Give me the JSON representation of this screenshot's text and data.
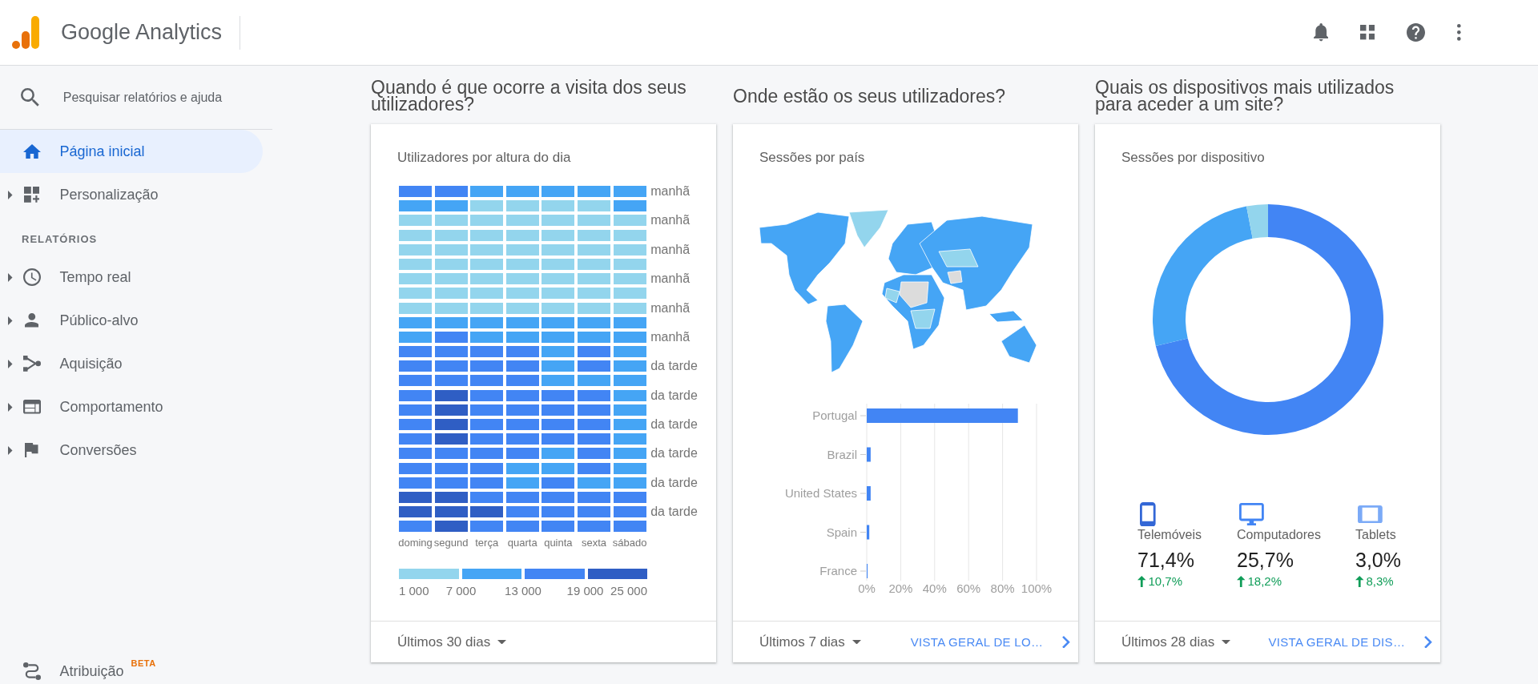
{
  "header": {
    "title": "Google Analytics"
  },
  "sidebar": {
    "search": {
      "placeholder": "Pesquisar relatórios e ajuda"
    },
    "groups": [
      {
        "items": [
          {
            "label": "Página inicial",
            "selected": true,
            "expandable": false
          },
          {
            "label": "Personalização",
            "selected": false,
            "expandable": true
          }
        ]
      },
      {
        "heading": "RELATÓRIOS",
        "items": [
          {
            "label": "Tempo real",
            "selected": false,
            "expandable": true
          },
          {
            "label": "Público-alvo",
            "selected": false,
            "expandable": true
          },
          {
            "label": "Aquisição",
            "selected": false,
            "expandable": true
          },
          {
            "label": "Comportamento",
            "selected": false,
            "expandable": true
          },
          {
            "label": "Conversões",
            "selected": false,
            "expandable": true
          }
        ]
      }
    ],
    "bottom_item": {
      "label": "Atribuição",
      "badge": "BETA",
      "selected": false,
      "expandable": false
    }
  },
  "sections": [
    {
      "kind": "heatmap",
      "heading": "Quando é que ocorre a visita dos seus utilizadores?",
      "card": {
        "title": "Utilizadores por altura do dia",
        "heatmap": {
          "rows": [
            {
              "label": "manhã",
              "cells": [
                {
                  "color": "#4285f4"
                },
                {
                  "color": "#4285f4"
                },
                {
                  "color": "#45a5f5"
                },
                {
                  "color": "#45a5f5"
                },
                {
                  "color": "#45a5f5"
                },
                {
                  "color": "#45a5f5"
                },
                {
                  "color": "#45a5f5"
                }
              ]
            },
            {
              "cells": [
                {
                  "color": "#45a5f5"
                },
                {
                  "color": "#45a5f5"
                },
                {
                  "color": "#93d5ed"
                },
                {
                  "color": "#93d5ed"
                },
                {
                  "color": "#93d5ed"
                },
                {
                  "color": "#93d5ed"
                },
                {
                  "color": "#45a5f5"
                }
              ]
            },
            {
              "label": "manhã",
              "cells": [
                {
                  "color": "#93d5ed"
                },
                {
                  "color": "#93d5ed"
                },
                {
                  "color": "#93d5ed"
                },
                {
                  "color": "#93d5ed"
                },
                {
                  "color": "#93d5ed"
                },
                {
                  "color": "#93d5ed"
                },
                {
                  "color": "#93d5ed"
                }
              ]
            },
            {
              "cells": [
                {
                  "color": "#93d5ed"
                },
                {
                  "color": "#93d5ed"
                },
                {
                  "color": "#93d5ed"
                },
                {
                  "color": "#93d5ed"
                },
                {
                  "color": "#93d5ed"
                },
                {
                  "color": "#93d5ed"
                },
                {
                  "color": "#93d5ed"
                }
              ]
            },
            {
              "label": "manhã",
              "cells": [
                {
                  "color": "#93d5ed"
                },
                {
                  "color": "#93d5ed"
                },
                {
                  "color": "#93d5ed"
                },
                {
                  "color": "#93d5ed"
                },
                {
                  "color": "#93d5ed"
                },
                {
                  "color": "#93d5ed"
                },
                {
                  "color": "#93d5ed"
                }
              ]
            },
            {
              "cells": [
                {
                  "color": "#93d5ed"
                },
                {
                  "color": "#93d5ed"
                },
                {
                  "color": "#93d5ed"
                },
                {
                  "color": "#93d5ed"
                },
                {
                  "color": "#93d5ed"
                },
                {
                  "color": "#93d5ed"
                },
                {
                  "color": "#93d5ed"
                }
              ]
            },
            {
              "label": "manhã",
              "cells": [
                {
                  "color": "#93d5ed"
                },
                {
                  "color": "#93d5ed"
                },
                {
                  "color": "#93d5ed"
                },
                {
                  "color": "#93d5ed"
                },
                {
                  "color": "#93d5ed"
                },
                {
                  "color": "#93d5ed"
                },
                {
                  "color": "#93d5ed"
                }
              ]
            },
            {
              "cells": [
                {
                  "color": "#93d5ed"
                },
                {
                  "color": "#93d5ed"
                },
                {
                  "color": "#93d5ed"
                },
                {
                  "color": "#93d5ed"
                },
                {
                  "color": "#93d5ed"
                },
                {
                  "color": "#93d5ed"
                },
                {
                  "color": "#93d5ed"
                }
              ]
            },
            {
              "label": "manhã",
              "cells": [
                {
                  "color": "#93d5ed"
                },
                {
                  "color": "#93d5ed"
                },
                {
                  "color": "#93d5ed"
                },
                {
                  "color": "#93d5ed"
                },
                {
                  "color": "#93d5ed"
                },
                {
                  "color": "#93d5ed"
                },
                {
                  "color": "#93d5ed"
                }
              ]
            },
            {
              "cells": [
                {
                  "color": "#45a5f5"
                },
                {
                  "color": "#45a5f5"
                },
                {
                  "color": "#45a5f5"
                },
                {
                  "color": "#45a5f5"
                },
                {
                  "color": "#45a5f5"
                },
                {
                  "color": "#45a5f5"
                },
                {
                  "color": "#45a5f5"
                }
              ]
            },
            {
              "label": "manhã",
              "cells": [
                {
                  "color": "#45a5f5"
                },
                {
                  "color": "#4285f4"
                },
                {
                  "color": "#45a5f5"
                },
                {
                  "color": "#45a5f5"
                },
                {
                  "color": "#45a5f5"
                },
                {
                  "color": "#45a5f5"
                },
                {
                  "color": "#45a5f5"
                }
              ]
            },
            {
              "cells": [
                {
                  "color": "#4285f4"
                },
                {
                  "color": "#4285f4"
                },
                {
                  "color": "#4285f4"
                },
                {
                  "color": "#4285f4"
                },
                {
                  "color": "#45a5f5"
                },
                {
                  "color": "#4285f4"
                },
                {
                  "color": "#45a5f5"
                }
              ]
            },
            {
              "label": "da tarde",
              "cells": [
                {
                  "color": "#4285f4"
                },
                {
                  "color": "#4285f4"
                },
                {
                  "color": "#4285f4"
                },
                {
                  "color": "#4285f4"
                },
                {
                  "color": "#45a5f5"
                },
                {
                  "color": "#4285f4"
                },
                {
                  "color": "#45a5f5"
                }
              ]
            },
            {
              "cells": [
                {
                  "color": "#4285f4"
                },
                {
                  "color": "#4285f4"
                },
                {
                  "color": "#4285f4"
                },
                {
                  "color": "#4285f4"
                },
                {
                  "color": "#45a5f5"
                },
                {
                  "color": "#45a5f5"
                },
                {
                  "color": "#45a5f5"
                }
              ]
            },
            {
              "label": "da tarde",
              "cells": [
                {
                  "color": "#4285f4"
                },
                {
                  "color": "#2f5ec4"
                },
                {
                  "color": "#4285f4"
                },
                {
                  "color": "#4285f4"
                },
                {
                  "color": "#4285f4"
                },
                {
                  "color": "#4285f4"
                },
                {
                  "color": "#45a5f5"
                }
              ]
            },
            {
              "cells": [
                {
                  "color": "#4285f4"
                },
                {
                  "color": "#2f5ec4"
                },
                {
                  "color": "#4285f4"
                },
                {
                  "color": "#4285f4"
                },
                {
                  "color": "#4285f4"
                },
                {
                  "color": "#4285f4"
                },
                {
                  "color": "#45a5f5"
                }
              ]
            },
            {
              "label": "da tarde",
              "cells": [
                {
                  "color": "#4285f4"
                },
                {
                  "color": "#2f5ec4"
                },
                {
                  "color": "#4285f4"
                },
                {
                  "color": "#4285f4"
                },
                {
                  "color": "#4285f4"
                },
                {
                  "color": "#4285f4"
                },
                {
                  "color": "#45a5f5"
                }
              ]
            },
            {
              "cells": [
                {
                  "color": "#4285f4"
                },
                {
                  "color": "#2f5ec4"
                },
                {
                  "color": "#4285f4"
                },
                {
                  "color": "#4285f4"
                },
                {
                  "color": "#4285f4"
                },
                {
                  "color": "#4285f4"
                },
                {
                  "color": "#45a5f5"
                }
              ]
            },
            {
              "label": "da tarde",
              "cells": [
                {
                  "color": "#4285f4"
                },
                {
                  "color": "#4285f4"
                },
                {
                  "color": "#4285f4"
                },
                {
                  "color": "#4285f4"
                },
                {
                  "color": "#45a5f5"
                },
                {
                  "color": "#4285f4"
                },
                {
                  "color": "#45a5f5"
                }
              ]
            },
            {
              "cells": [
                {
                  "color": "#4285f4"
                },
                {
                  "color": "#4285f4"
                },
                {
                  "color": "#4285f4"
                },
                {
                  "color": "#45a5f5"
                },
                {
                  "color": "#45a5f5"
                },
                {
                  "color": "#4285f4"
                },
                {
                  "color": "#45a5f5"
                }
              ]
            },
            {
              "label": "da tarde",
              "cells": [
                {
                  "color": "#4285f4"
                },
                {
                  "color": "#4285f4"
                },
                {
                  "color": "#4285f4"
                },
                {
                  "color": "#45a5f5"
                },
                {
                  "color": "#4285f4"
                },
                {
                  "color": "#45a5f5"
                },
                {
                  "color": "#45a5f5"
                }
              ]
            },
            {
              "cells": [
                {
                  "color": "#2f5ec4"
                },
                {
                  "color": "#2f5ec4"
                },
                {
                  "color": "#4285f4"
                },
                {
                  "color": "#4285f4"
                },
                {
                  "color": "#4285f4"
                },
                {
                  "color": "#4285f4"
                },
                {
                  "color": "#4285f4"
                }
              ]
            },
            {
              "label": "da tarde",
              "cells": [
                {
                  "color": "#2f5ec4"
                },
                {
                  "color": "#2f5ec4"
                },
                {
                  "color": "#2f5ec4"
                },
                {
                  "color": "#4285f4"
                },
                {
                  "color": "#4285f4"
                },
                {
                  "color": "#4285f4"
                },
                {
                  "color": "#4285f4"
                }
              ]
            },
            {
              "cells": [
                {
                  "color": "#4285f4"
                },
                {
                  "color": "#2f5ec4"
                },
                {
                  "color": "#4285f4"
                },
                {
                  "color": "#4285f4"
                },
                {
                  "color": "#4285f4"
                },
                {
                  "color": "#4285f4"
                },
                {
                  "color": "#4285f4"
                }
              ]
            }
          ],
          "columns": [
            "doming",
            "segund",
            "terça",
            "quarta",
            "quinta",
            "sexta",
            "sábado"
          ],
          "legend": [
            {
              "color": "#93d5ed"
            },
            {
              "color": "#45a5f5"
            },
            {
              "color": "#4285f4"
            },
            {
              "color": "#2f5ec4"
            }
          ],
          "legend_labels": [
            "1 000",
            "7 000",
            "13 000",
            "19 000",
            "25 000"
          ]
        },
        "footer": {
          "range": "Últimos 30 dias"
        }
      }
    },
    {
      "kind": "geo",
      "heading": "Onde estão os seus utilizadores?",
      "card": {
        "title": "Sessões por país",
        "chart_data": {
          "type": "bar",
          "orientation": "horizontal",
          "categories": [
            "Portugal",
            "Brazil",
            "United States",
            "Spain",
            "France"
          ],
          "series": [
            {
              "color": "#4285f4",
              "values": [
                89,
                2.3,
                2.3,
                1.5,
                0.5
              ]
            }
          ],
          "xlim": [
            0,
            100
          ],
          "xticks": [
            {
              "value": 0,
              "label": "0%"
            },
            {
              "value": 20,
              "label": "20%"
            },
            {
              "value": 40,
              "label": "40%"
            },
            {
              "value": 60,
              "label": "60%"
            },
            {
              "value": 80,
              "label": "80%"
            },
            {
              "value": 100,
              "label": "100%"
            }
          ],
          "grid": true
        },
        "footer": {
          "range": "Últimos 7 dias",
          "link": "VISTA GERAL DE LO…"
        }
      }
    },
    {
      "kind": "devices",
      "heading": "Quais os dispositivos mais utilizados para aceder a um site?",
      "card": {
        "title": "Sessões por dispositivo",
        "chart_data": {
          "type": "donut",
          "categories": [
            "Telemóveis",
            "Computadores",
            "Tablets"
          ],
          "values": [
            71.4,
            25.7,
            3.0
          ],
          "colors": [
            "#4285f4",
            "#45a5f5",
            "#93d5ed"
          ]
        },
        "devices": [
          {
            "value": "71,4%",
            "change": "10,7%",
            "rising": true,
            "color": "#3367d6"
          },
          {
            "value": "25,7%",
            "change": "18,2%",
            "rising": true,
            "color": "#4285f4"
          },
          {
            "value": "3,0%",
            "change": "8,3%",
            "rising": true,
            "color": "#7baaf7"
          }
        ],
        "footer": {
          "range": "Últimos 28 dias",
          "link": "VISTA GERAL DE DIS…"
        }
      }
    }
  ]
}
